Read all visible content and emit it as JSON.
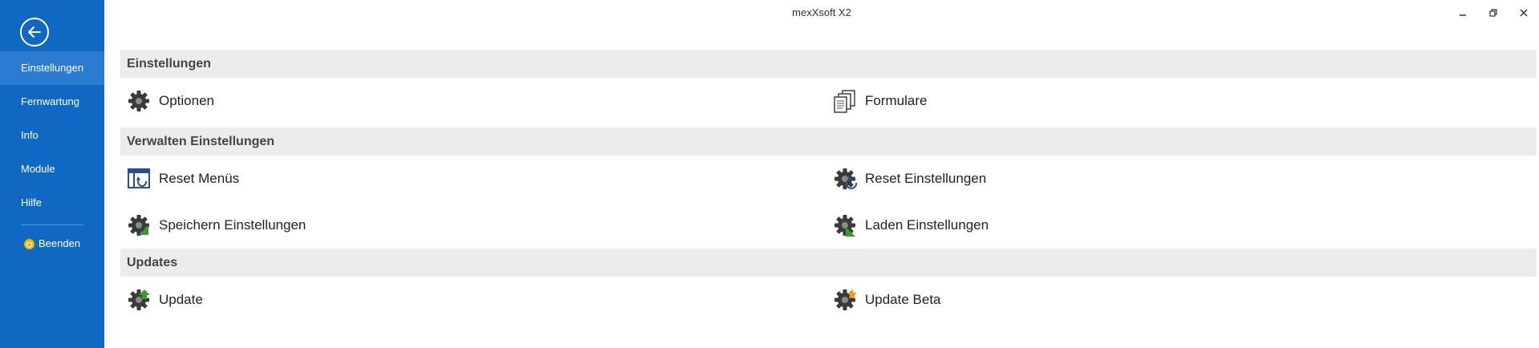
{
  "window": {
    "title": "mexXsoft X2"
  },
  "sidebar": {
    "items": [
      {
        "label": "Einstellungen",
        "active": true
      },
      {
        "label": "Fernwartung"
      },
      {
        "label": "Info"
      },
      {
        "label": "Module"
      },
      {
        "label": "Hilfe"
      }
    ],
    "quit_label": "Beenden"
  },
  "sections": {
    "settings": {
      "title": "Einstellungen",
      "optionen": "Optionen",
      "formulare": "Formulare"
    },
    "manage": {
      "title": "Verwalten Einstellungen",
      "reset_menus": "Reset Menüs",
      "reset_settings": "Reset Einstellungen",
      "save_settings": "Speichern Einstellungen",
      "load_settings": "Laden Einstellungen"
    },
    "updates": {
      "title": "Updates",
      "update": "Update",
      "update_beta": "Update Beta"
    }
  },
  "colors": {
    "sidebar": "#1168c2",
    "sidebar_active": "#2b7cd0",
    "section_bg": "#ececec",
    "gear": "#3a3a3a",
    "accent_green": "#3c9a2e",
    "accent_orange": "#f0a020"
  }
}
